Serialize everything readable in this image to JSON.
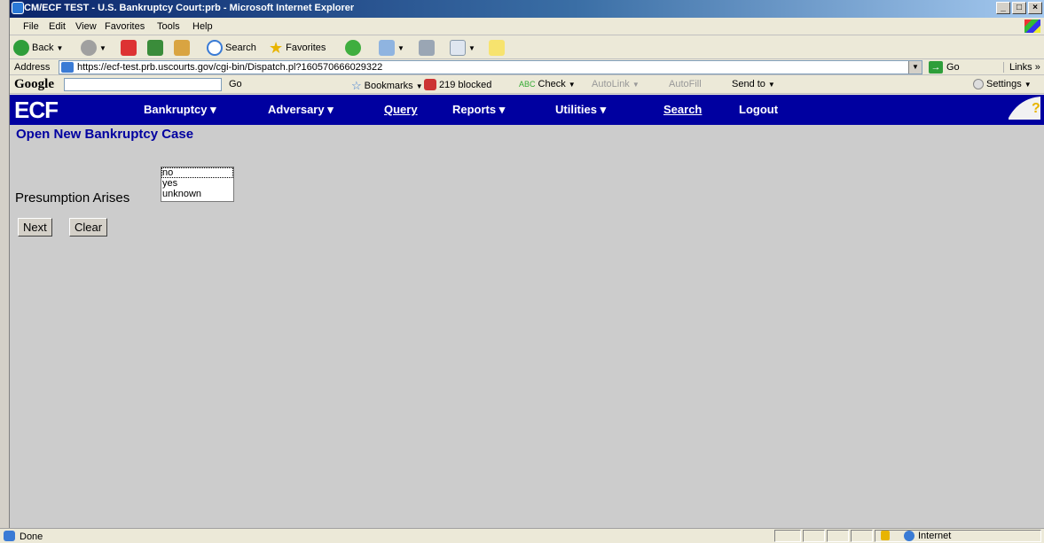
{
  "window": {
    "title": "CM/ECF TEST - U.S. Bankruptcy Court:prb - Microsoft Internet Explorer"
  },
  "menu": {
    "items": [
      "File",
      "Edit",
      "View",
      "Favorites",
      "Tools",
      "Help"
    ]
  },
  "toolbar": {
    "back": "Back",
    "search": "Search",
    "favorites": "Favorites"
  },
  "address": {
    "label": "Address",
    "url": "https://ecf-test.prb.uscourts.gov/cgi-bin/Dispatch.pl?160570666029322",
    "go": "Go",
    "links": "Links"
  },
  "google": {
    "logo": "Google",
    "go": "Go",
    "bookmarks": "Bookmarks",
    "blocked": "219 blocked",
    "check": "Check",
    "autolink": "AutoLink",
    "autofill": "AutoFill",
    "sendto": "Send to",
    "settings": "Settings"
  },
  "ecf": {
    "logo": "ECF",
    "nav": [
      "Bankruptcy",
      "Adversary",
      "Query",
      "Reports",
      "Utilities",
      "Search",
      "Logout"
    ]
  },
  "page": {
    "title": "Open New Bankruptcy Case",
    "presumption_label": "Presumption Arises",
    "options": [
      "no",
      "yes",
      "unknown"
    ],
    "selected": "no",
    "next": "Next",
    "clear": "Clear"
  },
  "status": {
    "text": "Done",
    "zone": "Internet"
  },
  "colors": {
    "ecf_bar": "#0000a0",
    "content_bg": "#cccccc",
    "title_color": "#0000a0"
  }
}
